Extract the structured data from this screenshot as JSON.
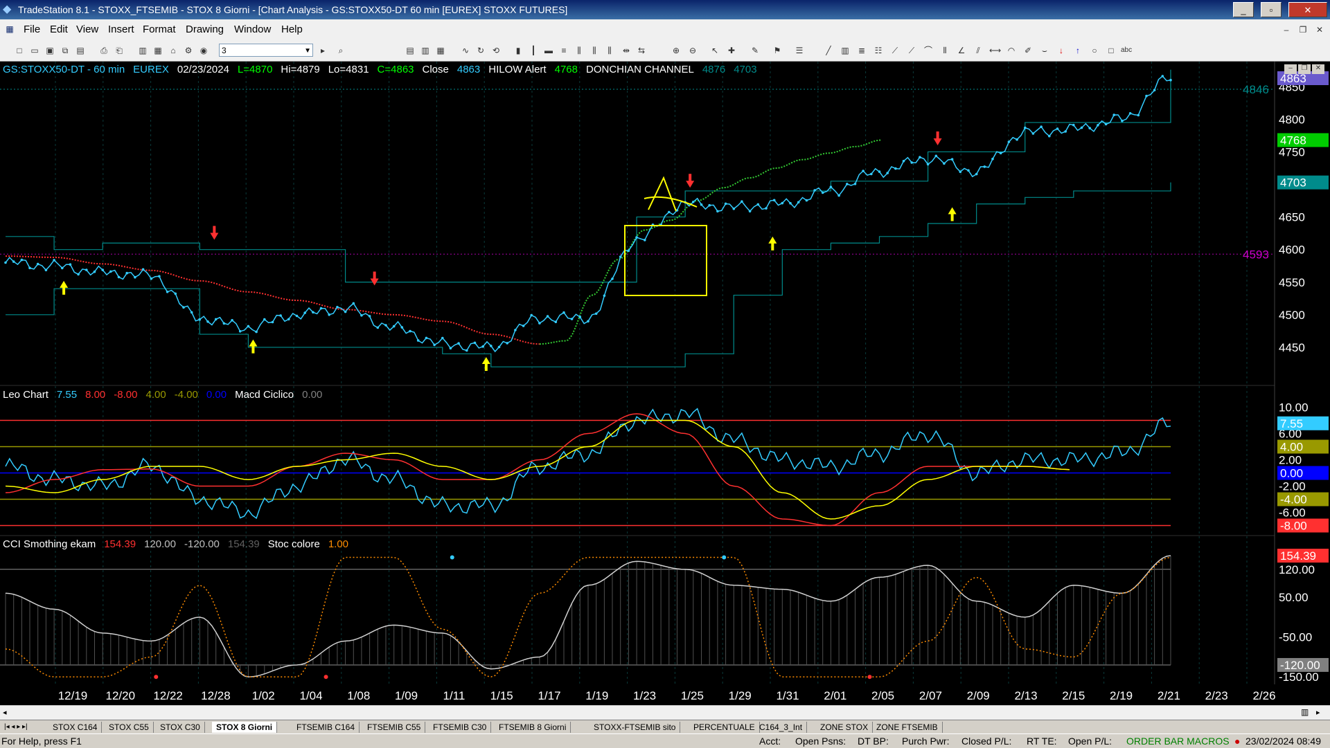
{
  "window": {
    "title": "TradeStation 8.1 - STOXX_FTSEMIB - STOX  8 Giorni - [Chart Analysis - GS:STOXX50-DT  60 min  [EUREX] STOXX FUTURES]"
  },
  "menu": [
    "File",
    "Edit",
    "View",
    "Insert",
    "Format",
    "Drawing",
    "Window",
    "Help"
  ],
  "toolbar": {
    "interval_value": "3"
  },
  "price_panel": {
    "header": [
      {
        "text": "GS:STOXX50-DT - 60 min",
        "color": "#33ccff"
      },
      {
        "text": "EUREX",
        "color": "#33ccff"
      },
      {
        "text": "02/23/2024",
        "color": "#ffffff"
      },
      {
        "text": "L=4870",
        "color": "#00ff00"
      },
      {
        "text": "Hi=4879",
        "color": "#ffffff"
      },
      {
        "text": "Lo=4831",
        "color": "#ffffff"
      },
      {
        "text": "C=4863",
        "color": "#00ff00"
      },
      {
        "text": "Close",
        "color": "#ffffff"
      },
      {
        "text": "4863",
        "color": "#33ccff"
      },
      {
        "text": "HILOW Alert",
        "color": "#ffffff"
      },
      {
        "text": "4768",
        "color": "#00ff00"
      },
      {
        "text": "DONCHIAN CHANNEL",
        "color": "#ffffff"
      },
      {
        "text": "4876",
        "color": "#008b8b"
      },
      {
        "text": "4703",
        "color": "#008b8b"
      }
    ],
    "y_ticks": [
      "4850",
      "4800",
      "4750",
      "4700",
      "4650",
      "4600",
      "4550",
      "4500",
      "4450"
    ],
    "right_labels": [
      {
        "text": "4846",
        "color": "#008b8b",
        "value": 4846,
        "boxed": false
      },
      {
        "text": "4863",
        "color": "#6a5acd",
        "value": 4863,
        "boxed": true
      },
      {
        "text": "4768",
        "color": "#00cc00",
        "value": 4768,
        "boxed": true
      },
      {
        "text": "4703",
        "color": "#008b8b",
        "value": 4703,
        "boxed": true
      },
      {
        "text": "4593",
        "color": "#cc00cc",
        "value": 4593,
        "boxed": false
      }
    ]
  },
  "osc_panel": {
    "header": [
      {
        "text": "Leo Chart",
        "color": "#ffffff"
      },
      {
        "text": "7.55",
        "color": "#33ccff"
      },
      {
        "text": "8.00",
        "color": "#ff3030"
      },
      {
        "text": "-8.00",
        "color": "#ff3030"
      },
      {
        "text": "4.00",
        "color": "#999900"
      },
      {
        "text": "-4.00",
        "color": "#999900"
      },
      {
        "text": "0.00",
        "color": "#0000ff"
      },
      {
        "text": "Macd Ciclico",
        "color": "#ffffff"
      },
      {
        "text": "0.00",
        "color": "#808080"
      }
    ],
    "y_ticks": [
      "10.00",
      "6.00",
      "2.00",
      "-2.00",
      "-6.00"
    ],
    "right_labels": [
      {
        "text": "7.55",
        "color": "#33ccff",
        "value": 7.55
      },
      {
        "text": "4.00",
        "color": "#999900",
        "value": 4.0
      },
      {
        "text": "0.00",
        "color": "#0000ff",
        "value": 0.0
      },
      {
        "text": "-4.00",
        "color": "#999900",
        "value": -4.0
      },
      {
        "text": "-8.00",
        "color": "#ff3030",
        "value": -8.0
      }
    ]
  },
  "cci_panel": {
    "header": [
      {
        "text": "CCI Smothing ekam",
        "color": "#ffffff"
      },
      {
        "text": "154.39",
        "color": "#ff3030"
      },
      {
        "text": "120.00",
        "color": "#c0c0c0"
      },
      {
        "text": "-120.00",
        "color": "#c0c0c0"
      },
      {
        "text": "154.39",
        "color": "#606060"
      },
      {
        "text": "Stoc colore",
        "color": "#ffffff"
      },
      {
        "text": "1.00",
        "color": "#ff8c00"
      }
    ],
    "y_ticks": [
      "120.00",
      "50.00",
      "-50.00",
      "-150.00"
    ],
    "right_labels": [
      {
        "text": "154.39",
        "color": "#ff3030",
        "value": 154.39
      },
      {
        "text": "-120.00",
        "color": "#808080",
        "value": -120.0
      }
    ]
  },
  "x_ticks": [
    "12/19",
    "12/20",
    "12/22",
    "12/28",
    "1/02",
    "1/04",
    "1/08",
    "1/09",
    "1/11",
    "1/15",
    "1/17",
    "1/19",
    "1/23",
    "1/25",
    "1/29",
    "1/31",
    "2/01",
    "2/05",
    "2/07",
    "2/09",
    "2/13",
    "2/15",
    "2/19",
    "2/21",
    "2/23",
    "2/26"
  ],
  "chart_data": [
    {
      "type": "line",
      "title": "GS:STOXX50-DT - 60 min",
      "x": [
        "12/19",
        "12/20",
        "12/22",
        "12/28",
        "1/02",
        "1/04",
        "1/08",
        "1/09",
        "1/11",
        "1/15",
        "1/17",
        "1/19",
        "1/23",
        "1/25",
        "1/29",
        "1/31",
        "2/01",
        "2/05",
        "2/07",
        "2/09",
        "2/13",
        "2/15",
        "2/19",
        "2/21",
        "2/23"
      ],
      "ylim": [
        4400,
        4880
      ],
      "series": [
        {
          "name": "Close",
          "color": "#33ccff",
          "values": [
            4580,
            4575,
            4565,
            4560,
            4495,
            4480,
            4500,
            4510,
            4480,
            4455,
            4450,
            4495,
            4495,
            4615,
            4670,
            4665,
            4670,
            4690,
            4720,
            4740,
            4720,
            4780,
            4785,
            4800,
            4863
          ]
        },
        {
          "name": "HILOW Alert",
          "color": "#ff3030",
          "values": [
            4590,
            4588,
            4578,
            4568,
            4552,
            4535,
            4522,
            4508,
            4500,
            4490,
            4470,
            4455,
            4460,
            4530,
            4585,
            4630,
            4645,
            4675,
            4695,
            4710,
            4725,
            4738,
            4748,
            4758,
            4768
          ]
        },
        {
          "name": "DONCHIAN CHANNEL",
          "color": "#008b8b",
          "upper": [
            4620,
            4600,
            4610,
            4610,
            4600,
            4600,
            4600,
            4550,
            4550,
            4550,
            4550,
            4550,
            4550,
            4650,
            4690,
            4690,
            4690,
            4705,
            4705,
            4750,
            4750,
            4795,
            4795,
            4795,
            4876
          ],
          "lower": [
            4500,
            4540,
            4540,
            4540,
            4470,
            4450,
            4450,
            4450,
            4450,
            4440,
            4420,
            4420,
            4420,
            4420,
            4440,
            4530,
            4600,
            4610,
            4620,
            4640,
            4670,
            4680,
            4690,
            4690,
            4703
          ]
        }
      ]
    },
    {
      "type": "line",
      "title": "Leo Chart",
      "x": [
        "12/19",
        "12/20",
        "12/22",
        "12/28",
        "1/02",
        "1/04",
        "1/08",
        "1/09",
        "1/11",
        "1/15",
        "1/17",
        "1/19",
        "1/23",
        "1/25",
        "1/29",
        "1/31",
        "2/01",
        "2/05",
        "2/07",
        "2/09",
        "2/13",
        "2/15",
        "2/19",
        "2/21",
        "2/23"
      ],
      "ylim": [
        -9,
        11
      ],
      "series": [
        {
          "name": "Leo Chart",
          "color": "#33ccff",
          "values": [
            1,
            -1,
            -2,
            1,
            -4,
            -6,
            -2,
            2,
            -1,
            -5,
            -5,
            1,
            3,
            8,
            9,
            5,
            2,
            1,
            3,
            6,
            0,
            2,
            2,
            3,
            7.55
          ]
        },
        {
          "name": "Macd Ciclico",
          "color": "#ff3030",
          "values": [
            -3,
            -1,
            0.5,
            0.6,
            -2,
            -2,
            1,
            3,
            2,
            -1,
            -1,
            2,
            6,
            9,
            6,
            -2,
            -7,
            -8,
            -3,
            1,
            1,
            1,
            0.5,
            null,
            null
          ]
        },
        {
          "name": "Macd Ciclico signal",
          "color": "#ffff00",
          "values": [
            -2,
            -3,
            -1,
            1,
            1,
            -1,
            1,
            2,
            3,
            1,
            -1,
            1,
            4,
            8,
            8,
            4,
            -3,
            -7,
            -5,
            -1,
            1,
            1,
            0.5,
            null,
            null
          ]
        }
      ]
    },
    {
      "type": "line",
      "title": "CCI Smothing ekam",
      "x": [
        "12/19",
        "12/20",
        "12/22",
        "12/28",
        "1/02",
        "1/04",
        "1/08",
        "1/09",
        "1/11",
        "1/15",
        "1/17",
        "1/19",
        "1/23",
        "1/25",
        "1/29",
        "1/31",
        "2/01",
        "2/05",
        "2/07",
        "2/09",
        "2/13",
        "2/15",
        "2/19",
        "2/21",
        "2/23"
      ],
      "ylim": [
        -160,
        170
      ],
      "series": [
        {
          "name": "CCI Smothing ekam",
          "color": "#d0d0d0",
          "values": [
            60,
            20,
            -40,
            -60,
            0,
            -150,
            -120,
            -60,
            -20,
            -40,
            -130,
            -100,
            80,
            140,
            120,
            80,
            70,
            40,
            100,
            130,
            40,
            0,
            80,
            60,
            154.39
          ]
        },
        {
          "name": "Stoc colore",
          "color": "#ff8c00",
          "values": [
            -80,
            -150,
            -150,
            -100,
            80,
            -150,
            -150,
            150,
            150,
            -30,
            -150,
            60,
            150,
            150,
            150,
            150,
            -150,
            -150,
            -150,
            -60,
            100,
            -80,
            -100,
            60,
            150
          ]
        }
      ]
    }
  ],
  "tabs": [
    "STOX C164",
    "STOX C55",
    "STOX  C30",
    "STOX  8 Giorni",
    "FTSEMIB C164",
    "FTSEMIB C55",
    "FTSEMIB C30",
    "FTSEMIB  8 Giorni",
    "STOXX-FTSEMIB sito",
    "PERCENTUALE",
    "C164_3_Int",
    "ZONE STOX",
    "ZONE FTSEMIB"
  ],
  "active_tab": "STOX  8 Giorni",
  "status": {
    "help": "For Help, press F1",
    "acct": "Acct:",
    "open_psns": "Open Psns:",
    "dt_bp": "DT BP:",
    "purch_pwr": "Purch Pwr:",
    "closed_pl": "Closed P/L:",
    "rt_te": "RT TE:",
    "open_pl": "Open P/L:",
    "order_bar": "ORDER BAR  MACROS",
    "datetime": "23/02/2024 08:49"
  },
  "colors": {
    "price": "#33ccff",
    "bearish_ma": "#ff3030",
    "bullish_ma": "#33cc33",
    "donchian": "#008b8b",
    "annotation": "#ffff00"
  }
}
